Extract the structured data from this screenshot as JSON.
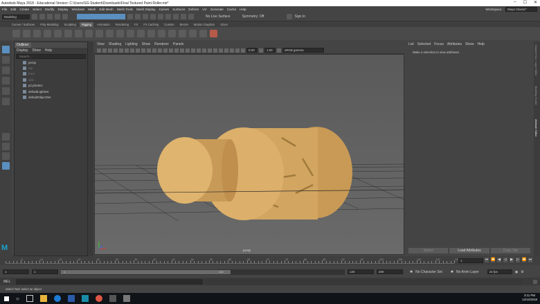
{
  "window": {
    "title": "Autodesk Maya 2018 - Educational Version: C:\\Users\\SG-Student\\Downloads\\Final Textured Paint Roller.mb*",
    "workspace_label": "Workspace :",
    "workspace_value": "Maya Classic*"
  },
  "menubar": {
    "items": [
      "File",
      "Edit",
      "Create",
      "Select",
      "Modify",
      "Display",
      "Windows",
      "Mesh",
      "Edit Mesh",
      "Mesh Tools",
      "Mesh Display",
      "Curves",
      "Surfaces",
      "Deform",
      "UV",
      "Generate",
      "Cache",
      "Help"
    ]
  },
  "status": {
    "mode": "Modeling",
    "live_surface": "No Live Surface",
    "symmetry": "Symmetry: Off",
    "sign_in": "Sign In"
  },
  "shelf_tabs": [
    "Curves / Surfaces",
    "Poly Modeling",
    "Sculpting",
    "Rigging",
    "Animation",
    "Rendering",
    "FX",
    "FX Caching",
    "Custom",
    "MASH",
    "Motion Graphics",
    "XGen"
  ],
  "shelf_active": "Rigging",
  "outliner": {
    "title": "Outliner",
    "menu": [
      "Display",
      "Show",
      "Help"
    ],
    "search_placeholder": "Search...",
    "items": [
      {
        "label": "persp",
        "dim": false
      },
      {
        "label": "top",
        "dim": true
      },
      {
        "label": "front",
        "dim": true
      },
      {
        "label": "side",
        "dim": true
      },
      {
        "label": "pCylinder1",
        "dim": false
      },
      {
        "label": "defaultLightSet",
        "dim": false
      },
      {
        "label": "defaultObjectSet",
        "dim": false
      }
    ]
  },
  "viewport": {
    "menu": [
      "View",
      "Shading",
      "Lighting",
      "Show",
      "Renderer",
      "Panels"
    ],
    "exposure": "0.00",
    "gamma": "1.00",
    "color_space": "sRGB gamma",
    "camera_label": "persp"
  },
  "attribute_editor": {
    "menu": [
      "List",
      "Selected",
      "Focus",
      "Attributes",
      "Show",
      "Help"
    ],
    "message": "Make a selection to view attributes",
    "buttons": [
      "Select",
      "Load Attributes",
      "Copy Tab"
    ]
  },
  "right_tabs": [
    "Channel Box / Layer Editor",
    "Modeling Toolkit",
    "Attribute Editor"
  ],
  "timeline": {
    "ticks": [
      "5",
      "10",
      "15",
      "20",
      "25",
      "30",
      "35",
      "40",
      "45",
      "50",
      "55",
      "60",
      "65",
      "70",
      "75",
      "80",
      "85",
      "90",
      "95",
      "100",
      "105",
      "110",
      "115",
      "120"
    ],
    "current_frame": "1"
  },
  "range": {
    "start": "1",
    "start2": "1",
    "inner_start": "1",
    "inner_end": "120",
    "end": "120",
    "end2": "200",
    "character_set": "No Character Set",
    "anim_layer": "No Anim Layer",
    "fps": "24 fps"
  },
  "command": {
    "lang": "MEL"
  },
  "help_line": "Select Tool: select an object",
  "taskbar": {
    "time": "3:11 PM",
    "date": "12/12/2018"
  }
}
